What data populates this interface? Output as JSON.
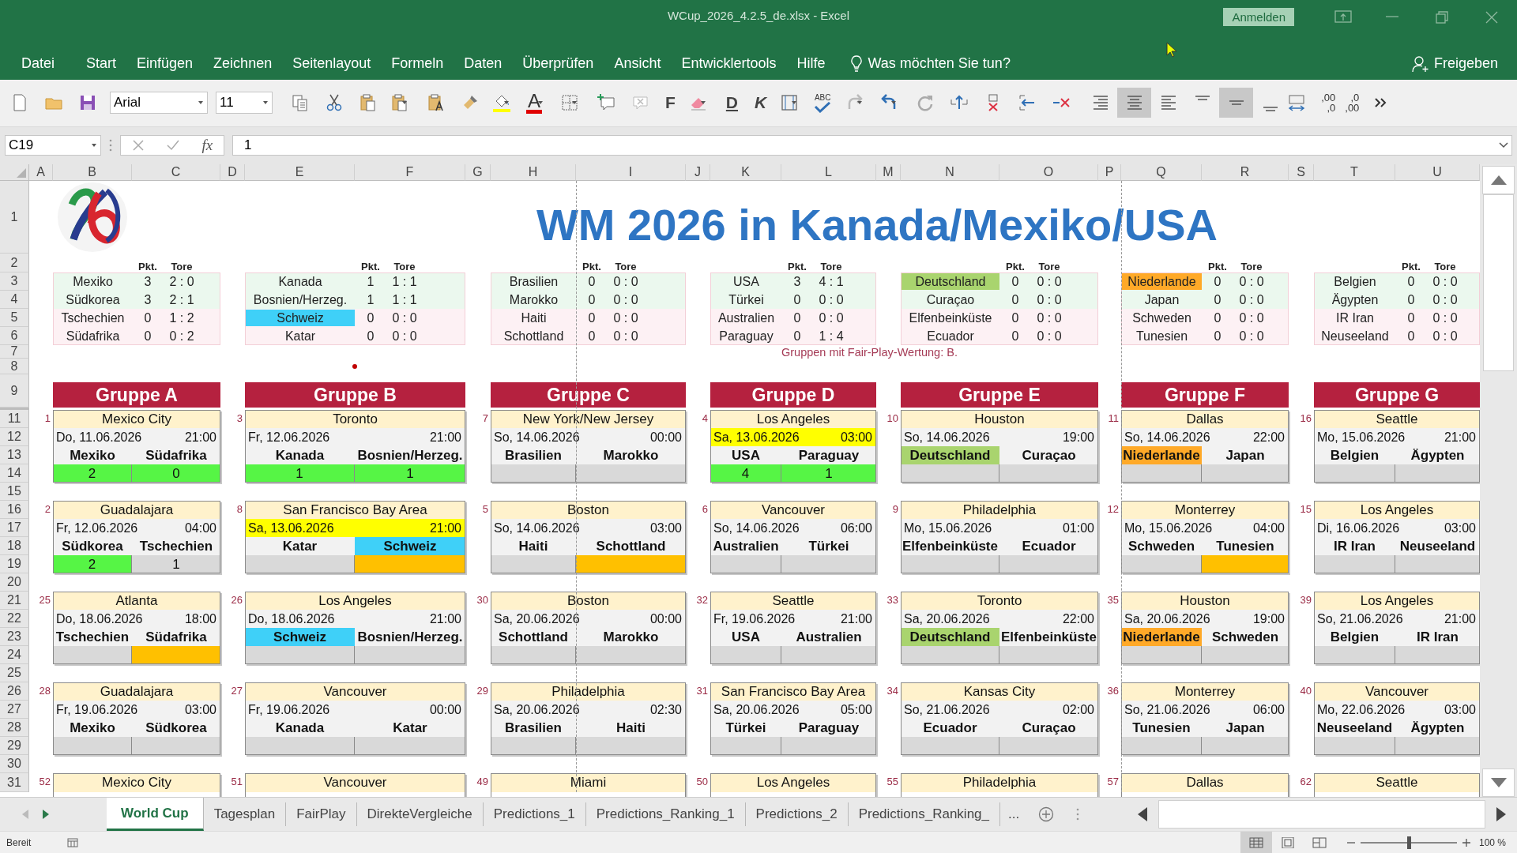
{
  "window": {
    "title": "WCup_2026_4.2.5_de.xlsx  -  Excel",
    "sign_in": "Anmelden"
  },
  "menu": {
    "items": [
      "Datei",
      "Start",
      "Einfügen",
      "Zeichnen",
      "Seitenlayout",
      "Formeln",
      "Daten",
      "Überprüfen",
      "Ansicht",
      "Entwicklertools",
      "Hilfe"
    ],
    "search": "Was möchten Sie tun?",
    "share": "Freigeben"
  },
  "toolbar": {
    "font": "Arial",
    "size": "11",
    "font_color_label": "A",
    "bold": "F",
    "underline": "D",
    "italic": "K",
    "spelling": "ABC",
    "increase_decimal": [
      ",00",
      ",0"
    ],
    "decrease_decimal": [
      ",0",
      ",00"
    ],
    "alignment": [
      {
        "selected": false
      },
      {
        "selected": true
      },
      {
        "selected": false
      },
      {
        "selected": false
      },
      {
        "selected": true
      },
      {
        "selected": false
      }
    ]
  },
  "formula_bar": {
    "cell": "C19",
    "function_label": "fx",
    "value": "1"
  },
  "sheet": {
    "columns": [
      "A",
      "B",
      "C",
      "D",
      "E",
      "F",
      "G",
      "H",
      "I",
      "J",
      "K",
      "L",
      "M",
      "N",
      "O",
      "P",
      "Q",
      "R",
      "S",
      "T",
      "U"
    ],
    "rows": [
      "1",
      "2",
      "3",
      "4",
      "5",
      "6",
      "7",
      "8",
      "9",
      "11",
      "12",
      "13",
      "14",
      "15",
      "16",
      "17",
      "18",
      "19",
      "20",
      "21",
      "22",
      "23",
      "24",
      "25",
      "26",
      "27",
      "28",
      "29",
      "30",
      "31"
    ],
    "title": "WM 2026 in Kanada/Mexiko/USA",
    "fair_play_note": "Gruppen mit Fair-Play-Wertung:  B.",
    "groups": [
      {
        "name": "Gruppe A",
        "points_header": "Pkt.",
        "goals_header": "Tore",
        "teams": [
          {
            "name": "Mexiko",
            "points": "3",
            "goals": "2 : 0",
            "qualifying": true
          },
          {
            "name": "Südkorea",
            "points": "3",
            "goals": "2 : 1",
            "qualifying": true
          },
          {
            "name": "Tschechien",
            "points": "0",
            "goals": "1 : 2",
            "qualifying": false
          },
          {
            "name": "Südafrika",
            "points": "0",
            "goals": "0 : 2",
            "qualifying": false
          }
        ],
        "matches": [
          {
            "number": "1",
            "venue": "Mexico City",
            "date": "Do, 11.06.2026",
            "time": "21:00",
            "highlighted": false,
            "home": {
              "name": "Mexiko"
            },
            "away": {
              "name": "Südafrika"
            },
            "home_score": {
              "value": "2",
              "color": "#56f545"
            },
            "away_score": {
              "value": "0",
              "color": "#56f545"
            }
          },
          {
            "number": "2",
            "venue": "Guadalajara",
            "date": "Fr, 12.06.2026",
            "time": "04:00",
            "highlighted": false,
            "home": {
              "name": "Südkorea"
            },
            "away": {
              "name": "Tschechien"
            },
            "home_score": {
              "value": "2",
              "color": "#56f545"
            },
            "away_score": {
              "value": "1",
              "color": "#d9d9d9"
            }
          },
          {
            "number": "25",
            "venue": "Atlanta",
            "date": "Do, 18.06.2026",
            "time": "18:00",
            "highlighted": false,
            "home": {
              "name": "Tschechien"
            },
            "away": {
              "name": "Südafrika"
            },
            "home_score": {
              "color": "#d9d9d9"
            },
            "away_score": {
              "color": "#ffc000"
            }
          },
          {
            "number": "28",
            "venue": "Guadalajara",
            "date": "Fr, 19.06.2026",
            "time": "03:00",
            "highlighted": false,
            "home": {
              "name": "Mexiko"
            },
            "away": {
              "name": "Südkorea"
            },
            "home_score": {
              "color": "#d9d9d9"
            },
            "away_score": {
              "color": "#d9d9d9"
            }
          },
          {
            "number": "52",
            "venue": "Mexico City"
          }
        ]
      },
      {
        "name": "Gruppe B",
        "points_header": "Pkt.",
        "goals_header": "Tore",
        "teams": [
          {
            "name": "Kanada",
            "points": "1",
            "goals": "1 : 1",
            "qualifying": true
          },
          {
            "name": "Bosnien/Herzeg.",
            "points": "1",
            "goals": "1 : 1",
            "qualifying": true
          },
          {
            "name": "Schweiz",
            "points": "0",
            "goals": "0 : 0",
            "qualifying": false,
            "color": "#3fd0f8"
          },
          {
            "name": "Katar",
            "points": "0",
            "goals": "0 : 0",
            "qualifying": false
          }
        ],
        "matches": [
          {
            "number": "3",
            "venue": "Toronto",
            "date": "Fr, 12.06.2026",
            "time": "21:00",
            "highlighted": false,
            "home": {
              "name": "Kanada"
            },
            "away": {
              "name": "Bosnien/Herzeg."
            },
            "home_score": {
              "value": "1",
              "color": "#56f545"
            },
            "away_score": {
              "value": "1",
              "color": "#56f545"
            }
          },
          {
            "number": "8",
            "venue": "San Francisco Bay Area",
            "date": "Sa, 13.06.2026",
            "time": "21:00",
            "highlighted": true,
            "home": {
              "name": "Katar"
            },
            "away": {
              "name": "Schweiz",
              "color": "#3fd0f8"
            },
            "home_score": {
              "color": "#d9d9d9"
            },
            "away_score": {
              "color": "#ffc000"
            }
          },
          {
            "number": "26",
            "venue": "Los Angeles",
            "date": "Do, 18.06.2026",
            "time": "21:00",
            "highlighted": false,
            "home": {
              "name": "Schweiz",
              "color": "#3fd0f8"
            },
            "away": {
              "name": "Bosnien/Herzeg."
            },
            "home_score": {
              "color": "#d9d9d9"
            },
            "away_score": {
              "color": "#d9d9d9"
            }
          },
          {
            "number": "27",
            "venue": "Vancouver",
            "date": "Fr, 19.06.2026",
            "time": "00:00",
            "highlighted": false,
            "home": {
              "name": "Kanada"
            },
            "away": {
              "name": "Katar"
            },
            "home_score": {
              "color": "#d9d9d9"
            },
            "away_score": {
              "color": "#d9d9d9"
            }
          },
          {
            "number": "51",
            "venue": "Vancouver"
          }
        ]
      },
      {
        "name": "Gruppe C",
        "points_header": "Pkt.",
        "goals_header": "Tore",
        "teams": [
          {
            "name": "Brasilien",
            "points": "0",
            "goals": "0 : 0",
            "qualifying": true
          },
          {
            "name": "Marokko",
            "points": "0",
            "goals": "0 : 0",
            "qualifying": true
          },
          {
            "name": "Haiti",
            "points": "0",
            "goals": "0 : 0",
            "qualifying": false
          },
          {
            "name": "Schottland",
            "points": "0",
            "goals": "0 : 0",
            "qualifying": false
          }
        ],
        "matches": [
          {
            "number": "7",
            "venue": "New York/New Jersey",
            "date": "So, 14.06.2026",
            "time": "00:00",
            "highlighted": false,
            "home": {
              "name": "Brasilien"
            },
            "away": {
              "name": "Marokko"
            },
            "home_score": {
              "color": "#d9d9d9"
            },
            "away_score": {
              "color": "#d9d9d9"
            }
          },
          {
            "number": "5",
            "venue": "Boston",
            "date": "So, 14.06.2026",
            "time": "03:00",
            "highlighted": false,
            "home": {
              "name": "Haiti"
            },
            "away": {
              "name": "Schottland"
            },
            "home_score": {
              "color": "#d9d9d9"
            },
            "away_score": {
              "color": "#ffc000"
            }
          },
          {
            "number": "30",
            "venue": "Boston",
            "date": "Sa, 20.06.2026",
            "time": "00:00",
            "highlighted": false,
            "home": {
              "name": "Schottland"
            },
            "away": {
              "name": "Marokko"
            },
            "home_score": {
              "color": "#d9d9d9"
            },
            "away_score": {
              "color": "#d9d9d9"
            }
          },
          {
            "number": "29",
            "venue": "Philadelphia",
            "date": "Sa, 20.06.2026",
            "time": "02:30",
            "highlighted": false,
            "home": {
              "name": "Brasilien"
            },
            "away": {
              "name": "Haiti"
            },
            "home_score": {
              "color": "#d9d9d9"
            },
            "away_score": {
              "color": "#d9d9d9"
            }
          },
          {
            "number": "49",
            "venue": "Miami"
          }
        ]
      },
      {
        "name": "Gruppe D",
        "points_header": "Pkt.",
        "goals_header": "Tore",
        "teams": [
          {
            "name": "USA",
            "points": "3",
            "goals": "4 : 1",
            "qualifying": true
          },
          {
            "name": "Türkei",
            "points": "0",
            "goals": "0 : 0",
            "qualifying": true
          },
          {
            "name": "Australien",
            "points": "0",
            "goals": "0 : 0",
            "qualifying": false
          },
          {
            "name": "Paraguay",
            "points": "0",
            "goals": "1 : 4",
            "qualifying": false
          }
        ],
        "matches": [
          {
            "number": "4",
            "venue": "Los Angeles",
            "date": "Sa, 13.06.2026",
            "time": "03:00",
            "highlighted": true,
            "home": {
              "name": "USA"
            },
            "away": {
              "name": "Paraguay"
            },
            "home_score": {
              "value": "4",
              "color": "#56f545"
            },
            "away_score": {
              "value": "1",
              "color": "#56f545"
            }
          },
          {
            "number": "6",
            "venue": "Vancouver",
            "date": "So, 14.06.2026",
            "time": "06:00",
            "highlighted": false,
            "home": {
              "name": "Australien"
            },
            "away": {
              "name": "Türkei"
            },
            "home_score": {
              "color": "#d9d9d9"
            },
            "away_score": {
              "color": "#d9d9d9"
            }
          },
          {
            "number": "32",
            "venue": "Seattle",
            "date": "Fr, 19.06.2026",
            "time": "21:00",
            "highlighted": false,
            "home": {
              "name": "USA"
            },
            "away": {
              "name": "Australien"
            },
            "home_score": {
              "color": "#d9d9d9"
            },
            "away_score": {
              "color": "#d9d9d9"
            }
          },
          {
            "number": "31",
            "venue": "San Francisco Bay Area",
            "date": "Sa, 20.06.2026",
            "time": "05:00",
            "highlighted": false,
            "home": {
              "name": "Türkei"
            },
            "away": {
              "name": "Paraguay"
            },
            "home_score": {
              "color": "#d9d9d9"
            },
            "away_score": {
              "color": "#d9d9d9"
            }
          },
          {
            "number": "50",
            "venue": "Los Angeles"
          }
        ]
      },
      {
        "name": "Gruppe E",
        "points_header": "Pkt.",
        "goals_header": "Tore",
        "teams": [
          {
            "name": "Deutschland",
            "points": "0",
            "goals": "0 : 0",
            "qualifying": true,
            "color": "#a9d46e"
          },
          {
            "name": "Curaçao",
            "points": "0",
            "goals": "0 : 0",
            "qualifying": true
          },
          {
            "name": "Elfenbeinküste",
            "points": "0",
            "goals": "0 : 0",
            "qualifying": false
          },
          {
            "name": "Ecuador",
            "points": "0",
            "goals": "0 : 0",
            "qualifying": false
          }
        ],
        "matches": [
          {
            "number": "10",
            "venue": "Houston",
            "date": "So, 14.06.2026",
            "time": "19:00",
            "highlighted": false,
            "home": {
              "name": "Deutschland",
              "color": "#a9d46e"
            },
            "away": {
              "name": "Curaçao"
            },
            "home_score": {
              "color": "#d9d9d9"
            },
            "away_score": {
              "color": "#d9d9d9"
            }
          },
          {
            "number": "9",
            "venue": "Philadelphia",
            "date": "Mo, 15.06.2026",
            "time": "01:00",
            "highlighted": false,
            "home": {
              "name": "Elfenbeinküste"
            },
            "away": {
              "name": "Ecuador"
            },
            "home_score": {
              "color": "#d9d9d9"
            },
            "away_score": {
              "color": "#d9d9d9"
            }
          },
          {
            "number": "33",
            "venue": "Toronto",
            "date": "Sa, 20.06.2026",
            "time": "22:00",
            "highlighted": false,
            "home": {
              "name": "Deutschland",
              "color": "#a9d46e"
            },
            "away": {
              "name": "Elfenbeinküste"
            },
            "home_score": {
              "color": "#d9d9d9"
            },
            "away_score": {
              "color": "#d9d9d9"
            }
          },
          {
            "number": "34",
            "venue": "Kansas City",
            "date": "So, 21.06.2026",
            "time": "02:00",
            "highlighted": false,
            "home": {
              "name": "Ecuador"
            },
            "away": {
              "name": "Curaçao"
            },
            "home_score": {
              "color": "#d9d9d9"
            },
            "away_score": {
              "color": "#d9d9d9"
            }
          },
          {
            "number": "55",
            "venue": "Philadelphia"
          }
        ]
      },
      {
        "name": "Gruppe F",
        "points_header": "Pkt.",
        "goals_header": "Tore",
        "teams": [
          {
            "name": "Niederlande",
            "points": "0",
            "goals": "0 : 0",
            "qualifying": true,
            "color": "#ffa928"
          },
          {
            "name": "Japan",
            "points": "0",
            "goals": "0 : 0",
            "qualifying": true
          },
          {
            "name": "Schweden",
            "points": "0",
            "goals": "0 : 0",
            "qualifying": false
          },
          {
            "name": "Tunesien",
            "points": "0",
            "goals": "0 : 0",
            "qualifying": false
          }
        ],
        "matches": [
          {
            "number": "11",
            "venue": "Dallas",
            "date": "So, 14.06.2026",
            "time": "22:00",
            "highlighted": false,
            "home": {
              "name": "Niederlande",
              "color": "#ffa928"
            },
            "away": {
              "name": "Japan"
            },
            "home_score": {
              "color": "#d9d9d9"
            },
            "away_score": {
              "color": "#d9d9d9"
            }
          },
          {
            "number": "12",
            "venue": "Monterrey",
            "date": "Mo, 15.06.2026",
            "time": "04:00",
            "highlighted": false,
            "home": {
              "name": "Schweden"
            },
            "away": {
              "name": "Tunesien"
            },
            "home_score": {
              "color": "#d9d9d9"
            },
            "away_score": {
              "color": "#ffc000"
            }
          },
          {
            "number": "35",
            "venue": "Houston",
            "date": "Sa, 20.06.2026",
            "time": "19:00",
            "highlighted": false,
            "home": {
              "name": "Niederlande",
              "color": "#ffa928"
            },
            "away": {
              "name": "Schweden"
            },
            "home_score": {
              "color": "#d9d9d9"
            },
            "away_score": {
              "color": "#d9d9d9"
            }
          },
          {
            "number": "36",
            "venue": "Monterrey",
            "date": "So, 21.06.2026",
            "time": "06:00",
            "highlighted": false,
            "home": {
              "name": "Tunesien"
            },
            "away": {
              "name": "Japan"
            },
            "home_score": {
              "color": "#d9d9d9"
            },
            "away_score": {
              "color": "#d9d9d9"
            }
          },
          {
            "number": "57",
            "venue": "Dallas"
          }
        ]
      },
      {
        "name": "Gruppe G",
        "points_header": "Pkt.",
        "goals_header": "Tore",
        "teams": [
          {
            "name": "Belgien",
            "points": "0",
            "goals": "0 : 0",
            "qualifying": true
          },
          {
            "name": "Ägypten",
            "points": "0",
            "goals": "0 : 0",
            "qualifying": true
          },
          {
            "name": "IR Iran",
            "points": "0",
            "goals": "0 : 0",
            "qualifying": false
          },
          {
            "name": "Neuseeland",
            "points": "0",
            "goals": "0 : 0",
            "qualifying": false
          }
        ],
        "matches": [
          {
            "number": "16",
            "venue": "Seattle",
            "date": "Mo, 15.06.2026",
            "time": "21:00",
            "highlighted": false,
            "home": {
              "name": "Belgien"
            },
            "away": {
              "name": "Ägypten"
            },
            "home_score": {
              "color": "#d9d9d9"
            },
            "away_score": {
              "color": "#d9d9d9"
            }
          },
          {
            "number": "15",
            "venue": "Los Angeles",
            "date": "Di, 16.06.2026",
            "time": "03:00",
            "highlighted": false,
            "home": {
              "name": "IR Iran"
            },
            "away": {
              "name": "Neuseeland"
            },
            "home_score": {
              "color": "#d9d9d9"
            },
            "away_score": {
              "color": "#d9d9d9"
            }
          },
          {
            "number": "39",
            "venue": "Los Angeles",
            "date": "So, 21.06.2026",
            "time": "21:00",
            "highlighted": false,
            "home": {
              "name": "Belgien"
            },
            "away": {
              "name": "IR Iran"
            },
            "home_score": {
              "color": "#d9d9d9"
            },
            "away_score": {
              "color": "#d9d9d9"
            }
          },
          {
            "number": "40",
            "venue": "Vancouver",
            "date": "Mo, 22.06.2026",
            "time": "03:00",
            "highlighted": false,
            "home": {
              "name": "Neuseeland"
            },
            "away": {
              "name": "Ägypten"
            },
            "home_score": {
              "color": "#d9d9d9"
            },
            "away_score": {
              "color": "#d9d9d9"
            }
          },
          {
            "number": "62",
            "venue": "Seattle"
          }
        ]
      }
    ]
  },
  "tabs": [
    {
      "label": "World Cup",
      "selected": true
    },
    {
      "label": "Tagesplan",
      "selected": false
    },
    {
      "label": "FairPlay",
      "selected": false
    },
    {
      "label": "DirekteVergleiche",
      "selected": false
    },
    {
      "label": "Predictions_1",
      "selected": false
    },
    {
      "label": "Predictions_Ranking_1",
      "selected": false
    },
    {
      "label": "Predictions_2",
      "selected": false
    },
    {
      "label": "Predictions_Ranking_",
      "selected": false
    }
  ],
  "tabs_more": "...",
  "status_bar": {
    "text": "Bereit",
    "views": [
      {
        "selected": true
      },
      {
        "selected": false
      },
      {
        "selected": false
      }
    ],
    "zoom_slider": {
      "level": 0.5
    },
    "zoom": "100 %"
  }
}
